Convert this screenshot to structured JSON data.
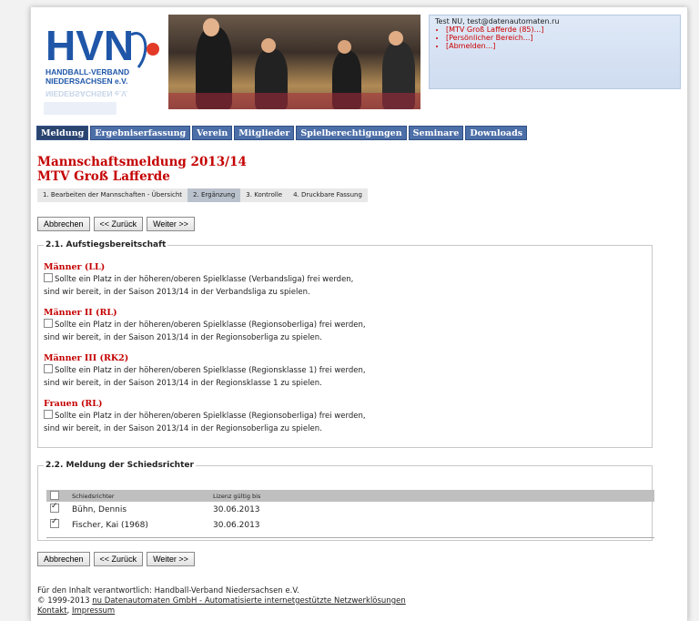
{
  "logo": {
    "letters": "HVN",
    "line1": "HANDBALL-VERBAND",
    "line2": "NIEDERSACHSEN e.V."
  },
  "user": {
    "line": "Test NU, test@datenautomaten.ru",
    "links": [
      "[MTV Groß Lafferde (85)...]",
      "[Persönlicher Bereich...]",
      "[Abmelden...]"
    ]
  },
  "nav": [
    "Meldung",
    "Ergebniserfassung",
    "Verein",
    "Mitglieder",
    "Spielberechtigungen",
    "Seminare",
    "Downloads"
  ],
  "page": {
    "title": "Mannschaftsmeldung 2013/14",
    "subtitle": "MTV Groß Lafferde"
  },
  "steps": [
    "1. Bearbeiten der Mannschaften - Übersicht",
    "2. Ergänzung",
    "3. Kontrolle",
    "4. Druckbare Fassung"
  ],
  "buttons": {
    "cancel": "Abbrechen",
    "back": "<< Zurück",
    "next": "Weiter >>"
  },
  "section1": {
    "legend": "2.1. Aufstiegsbereitschaft",
    "teams": [
      {
        "name": "Männer (LL)",
        "line1": "Sollte ein Platz in der höheren/oberen Spielklasse (Verbandsliga) frei werden,",
        "line2": "sind wir bereit, in der Saison 2013/14 in der Verbandsliga zu spielen."
      },
      {
        "name": "Männer II (RL)",
        "line1": "Sollte ein Platz in der höheren/oberen Spielklasse (Regionsoberliga) frei werden,",
        "line2": "sind wir bereit, in der Saison 2013/14 in der Regionsoberliga zu spielen."
      },
      {
        "name": "Männer III (RK2)",
        "line1": "Sollte ein Platz in der höheren/oberen Spielklasse (Regionsklasse 1) frei werden,",
        "line2": "sind wir bereit, in der Saison 2013/14 in der Regionsklasse 1 zu spielen."
      },
      {
        "name": "Frauen (RL)",
        "line1": "Sollte ein Platz in der höheren/oberen Spielklasse (Regionsoberliga) frei werden,",
        "line2": "sind wir bereit, in der Saison 2013/14 in der Regionsoberliga zu spielen."
      }
    ]
  },
  "section2": {
    "legend": "2.2. Meldung der Schiedsrichter",
    "headers": [
      "Schiedsrichter",
      "Lizenz gültig bis"
    ],
    "rows": [
      {
        "name": "Bühn, Dennis",
        "valid": "30.06.2013",
        "checked": true
      },
      {
        "name": "Fischer, Kai (1968)",
        "valid": "30.06.2013",
        "checked": true
      }
    ]
  },
  "footer": {
    "line1": "Für den Inhalt verantwortlich: Handball-Verband Niedersachsen e.V.",
    "copy": "© 1999-2013",
    "link": "nu Datenautomaten GmbH - Automatisierte internetgestützte Netzwerklösungen",
    "kontakt": "Kontakt",
    "impressum": "Impressum"
  },
  "colors": {
    "accent_red": "#c40000",
    "nav_blue": "#4d6fa8",
    "nav_active": "#2a4470"
  }
}
